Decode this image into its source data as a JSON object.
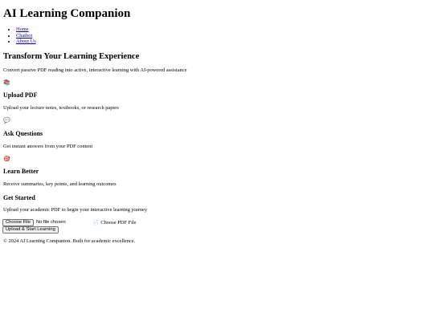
{
  "header": {
    "title": "AI Learning Companion",
    "nav": [
      {
        "label": "Home"
      },
      {
        "label": "Chatbot"
      },
      {
        "label": "About Us"
      }
    ]
  },
  "hero": {
    "title": "Transform Your Learning Experience",
    "subtitle": "Convert passive PDF reading into active, interactive learning with AI-powered assistance"
  },
  "features": [
    {
      "icon": "books-icon",
      "glyph": "📚",
      "title": "Upload PDF",
      "desc": "Upload your lecture notes, textbooks, or research papers"
    },
    {
      "icon": "speech-bubble-icon",
      "glyph": "💬",
      "title": "Ask Questions",
      "desc": "Get instant answers from your PDF content"
    },
    {
      "icon": "target-icon",
      "glyph": "🎯",
      "title": "Learn Better",
      "desc": "Receive summaries, key points, and learning outcomes"
    }
  ],
  "get_started": {
    "title": "Get Started",
    "desc": "Upload your academic PDF to begin your interactive learning journey",
    "file_button": "Choose File",
    "file_status": "No file chosen",
    "file_label_glyph": "📄",
    "file_label": "Choose PDF File",
    "submit_label": "Upload & Start Learning"
  },
  "footer": {
    "text": "© 2024 AI Learning Companion. Built for academic excellence."
  }
}
